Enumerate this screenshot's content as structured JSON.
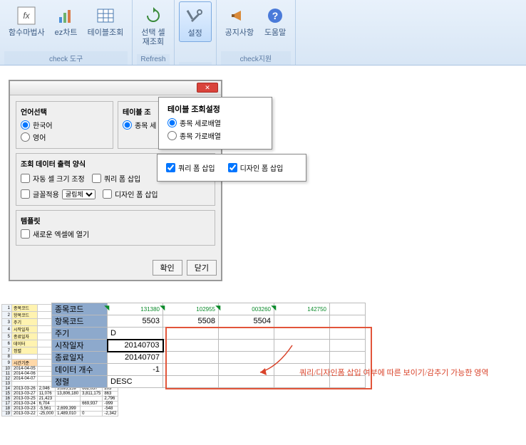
{
  "ribbon": {
    "groups": [
      {
        "label": "check 도구",
        "items": [
          {
            "name": "fx-wizard",
            "label": "함수마법사"
          },
          {
            "name": "ez-chart",
            "label": "ez차트"
          },
          {
            "name": "table-lookup",
            "label": "테이블조회"
          }
        ]
      },
      {
        "label": "Refresh",
        "items": [
          {
            "name": "select-cell-refresh",
            "label": "선택 셀\n재조회"
          }
        ]
      },
      {
        "label": "",
        "items": [
          {
            "name": "settings",
            "label": "설정",
            "active": true
          }
        ]
      },
      {
        "label": "check지원",
        "items": [
          {
            "name": "notice",
            "label": "공지사항"
          },
          {
            "name": "help",
            "label": "도움말"
          }
        ]
      }
    ]
  },
  "dialog": {
    "lang_title": "언어선택",
    "lang_ko": "한국어",
    "lang_en": "영어",
    "table_title": "테이블 조",
    "table_opt1": "종목 세",
    "output_title": "조회 데이터 출력 양식",
    "auto_resize": "자동 셀 크기 조정",
    "query_form": "쿼리 폼 삽입",
    "font_apply": "글꼴적용",
    "font_value": "굴림체",
    "design_form": "디자인 폼 삽입",
    "template_title": "템플릿",
    "open_new": "새로운 엑셀에 열기",
    "ok": "확인",
    "close": "닫기"
  },
  "callout1": {
    "title": "테이블 조회설정",
    "opt1": "종목 세로배열",
    "opt2": "종목 가로배열"
  },
  "callout2": {
    "chk1": "쿼리 폼 삽입",
    "chk2": "디자인 폼 삽입"
  },
  "grid": {
    "labels": [
      "종목코드",
      "항목코드",
      "주기",
      "시작일자",
      "종료일자",
      "데이터 개수",
      "정렬"
    ],
    "codes": [
      "131380",
      "102955",
      "003260",
      "142750"
    ],
    "row2": [
      "5503",
      "5508",
      "5504",
      ""
    ],
    "period": "D",
    "start": "20140703",
    "end": "20140707",
    "count": "-1",
    "sort": "DESC"
  },
  "annotation": "쿼리/디자인폼 삽입 여부에 따른 보이기/감추기 가능한 영역",
  "small_sheet_rows": [
    [
      "1",
      "종목코드",
      "",
      "",
      "",
      ""
    ],
    [
      "2",
      "항목코드",
      "",
      "",
      "",
      ""
    ],
    [
      "3",
      "주기",
      "",
      "",
      "",
      ""
    ],
    [
      "4",
      "시작일자",
      "",
      "",
      "",
      ""
    ],
    [
      "5",
      "종료일자",
      "",
      "",
      "",
      ""
    ],
    [
      "6",
      "데이터",
      "",
      "",
      "",
      ""
    ],
    [
      "7",
      "정렬",
      "",
      "",
      "",
      ""
    ],
    [
      "8",
      "",
      "",
      "",
      "",
      ""
    ],
    [
      "9",
      "시간기준",
      "",
      "",
      "",
      ""
    ],
    [
      "10",
      "2014-04-05",
      "",
      "",
      "",
      ""
    ],
    [
      "11",
      "2014-04-06",
      "",
      "",
      "",
      ""
    ],
    [
      "12",
      "2014-04-07",
      "",
      "",
      "",
      ""
    ],
    [
      "13",
      "",
      "",
      "",
      "",
      ""
    ],
    [
      "14",
      "2013-03-26",
      "2,046",
      "3,695,159",
      "662,037",
      "203"
    ],
    [
      "15",
      "2013-03-27",
      "11,076",
      "13,806,180",
      "3,811,175",
      "863"
    ],
    [
      "16",
      "2013-03-25",
      "21,423",
      "",
      "",
      "2,796"
    ],
    [
      "17",
      "2013-03-24",
      "6,704",
      "",
      "669,937",
      "-999"
    ],
    [
      "18",
      "2013-03-23",
      "-5,561",
      "2,699,399",
      "",
      "-548"
    ],
    [
      "19",
      "2013-03-22",
      "-25,000",
      "1,489,010",
      "0",
      "-2,342"
    ]
  ]
}
